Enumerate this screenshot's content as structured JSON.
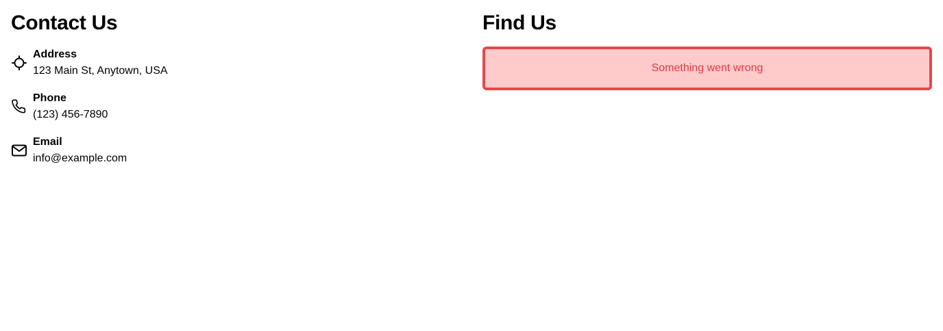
{
  "contact": {
    "title": "Contact Us",
    "items": [
      {
        "icon": "crosshair-icon",
        "label": "Address",
        "value": "123 Main St, Anytown, USA"
      },
      {
        "icon": "phone-icon",
        "label": "Phone",
        "value": "(123) 456-7890"
      },
      {
        "icon": "mail-icon",
        "label": "Email",
        "value": "info@example.com"
      }
    ]
  },
  "find": {
    "title": "Find Us",
    "error_message": "Something went wrong"
  },
  "colors": {
    "error_border": "#e5484d",
    "error_background": "#ffcaca",
    "error_text": "#dc3b41"
  }
}
